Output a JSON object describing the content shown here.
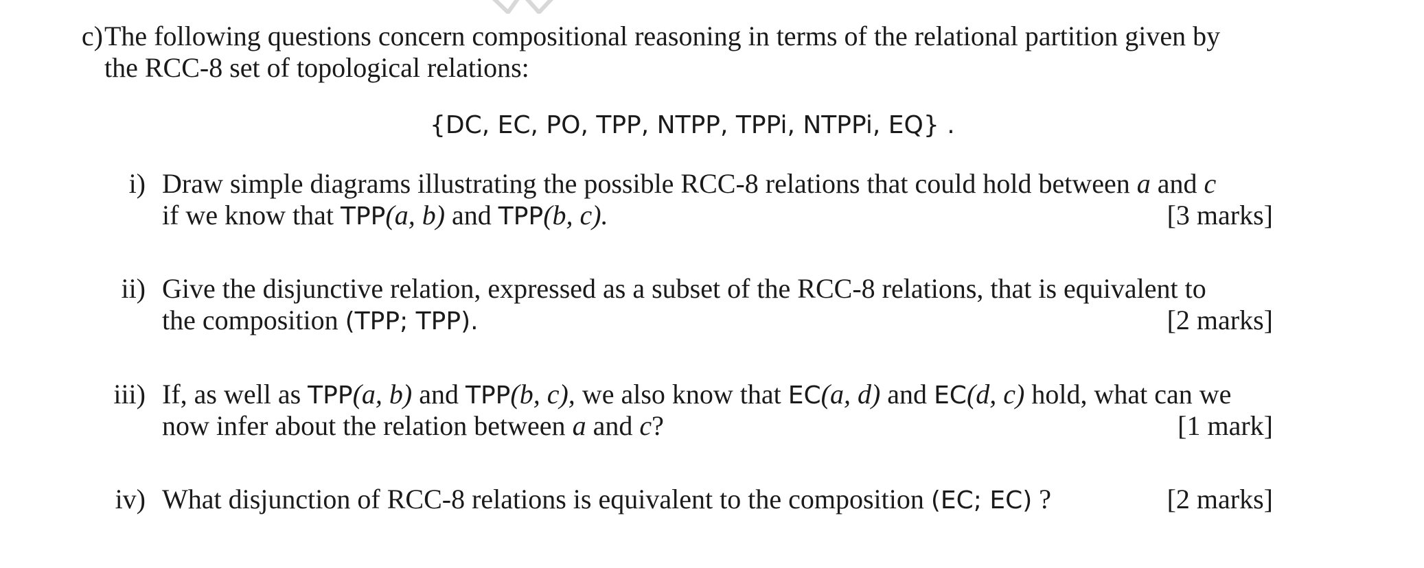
{
  "part": {
    "label": "c)",
    "intro_line1": "The following questions concern compositional reasoning in terms of the relational partition given by",
    "intro_line2": "the RCC-8 set of topological relations:",
    "relation_set": "{DC, EC, PO, TPP, NTPP, TPPi, NTPPi, EQ} ."
  },
  "questions": [
    {
      "label": "i)",
      "line1": "Draw simple diagrams illustrating the possible RCC-8 relations that could hold between",
      "line1_var_a": "a",
      "line1_and": "and",
      "line1_var_c": "c",
      "line2_pre": "if we know that",
      "tpp1": "TPP",
      "args1": "(a, b)",
      "mid": "and",
      "tpp2": "TPP",
      "args2": "(b, c).",
      "marks": "[3 marks]"
    },
    {
      "label": "ii)",
      "line1": "Give the disjunctive relation, expressed as a subset of the RCC-8 relations, that is equivalent to",
      "line2_pre": "the composition",
      "composition": "(TPP; TPP).",
      "marks": "[2 marks]"
    },
    {
      "label": "iii)",
      "line1_pre": "If, as well as",
      "tpp1": "TPP",
      "args1": "(a, b)",
      "and1": "and",
      "tpp2": "TPP",
      "args2": "(b, c),",
      "mid": "we also know that",
      "ec1": "EC",
      "args3": "(a, d)",
      "and2": "and",
      "ec2": "EC",
      "args4": "(d, c)",
      "line1_post": "hold, what can we",
      "line2_pre": "now infer about the relation between",
      "var_a": "a",
      "and3": "and",
      "var_c": "c",
      "q": "?",
      "marks": "[1 mark]"
    },
    {
      "label": "iv)",
      "line1": "What disjunction of RCC-8 relations is equivalent to the composition",
      "composition": "(EC; EC)",
      "q": "?",
      "marks": "[2 marks]"
    }
  ]
}
